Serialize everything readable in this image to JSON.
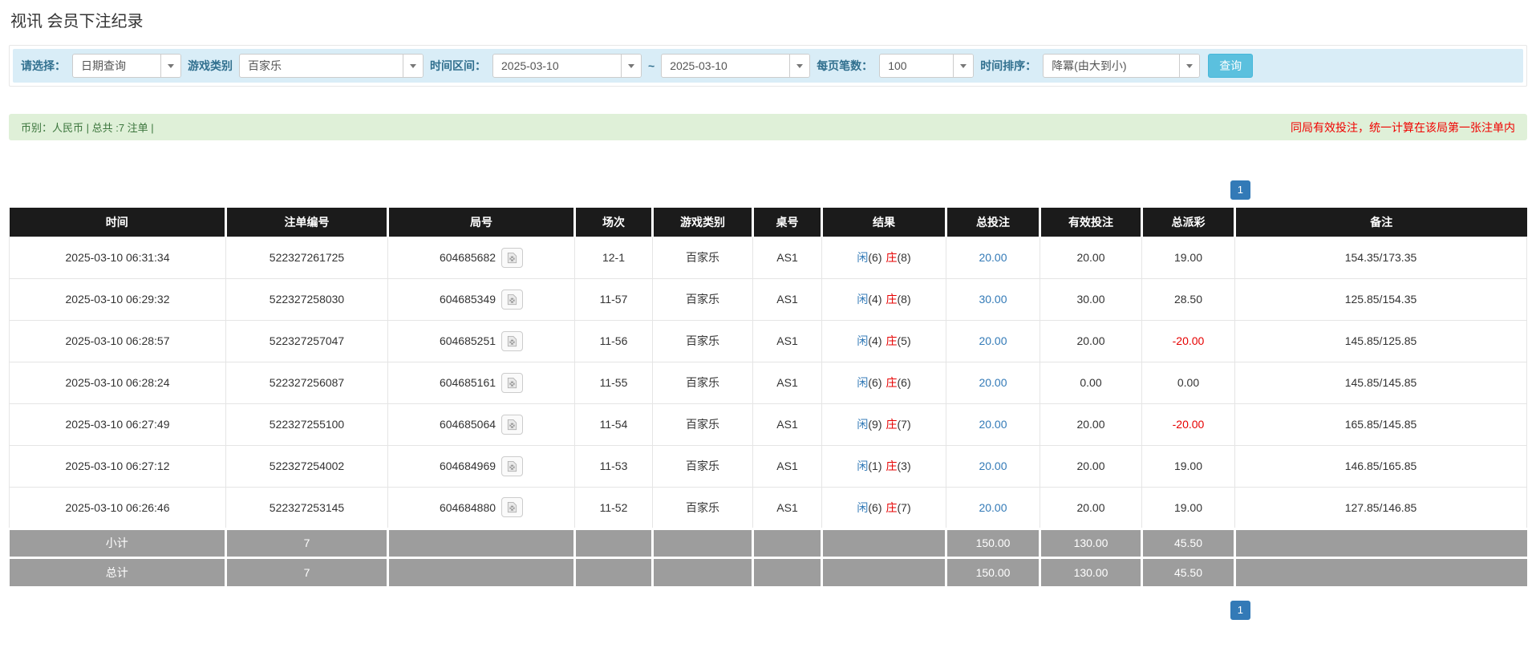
{
  "page_title": "视讯 会员下注纪录",
  "filter_bar": {
    "select_mode": {
      "label": "请选择：",
      "value": "日期查询"
    },
    "game_type": {
      "label": "游戏类别",
      "value": "百家乐"
    },
    "date_range": {
      "label": "时间区间：",
      "from": "2025-03-10",
      "separator": "~",
      "to": "2025-03-10"
    },
    "page_size": {
      "label": "每页笔数：",
      "value": "100"
    },
    "time_order": {
      "label": "时间排序：",
      "value": "降冪(由大到小)"
    },
    "query_button": "查询"
  },
  "summary_bar": {
    "left_text": "币别：人民币 | 总共 :7 注单 |",
    "right_notice": "同局有效投注，统一计算在该局第一张注单内"
  },
  "pagination": {
    "current_page": "1"
  },
  "icons": {
    "round_replay": "video-replay-icon",
    "select_caret": "chevron-down-icon"
  },
  "colors": {
    "accent_blue": "#337ab7",
    "info_bg": "#d9edf7",
    "success_bg": "#dff0d8",
    "header_bg": "#1b1b1b",
    "footer_bg": "#9d9d9d",
    "danger_red": "#e60000",
    "notice_red": "#f00200",
    "query_btn": "#5bc0de"
  },
  "table": {
    "headers": [
      "时间",
      "注单编号",
      "局号",
      "场次",
      "游戏类别",
      "桌号",
      "结果",
      "总投注",
      "有效投注",
      "总派彩",
      "备注"
    ],
    "rows": [
      {
        "time": "2025-03-10 06:31:34",
        "bet_id": "522327261725",
        "round_id": "604685682",
        "session": "12-1",
        "game": "百家乐",
        "table_no": "AS1",
        "result": {
          "player_label": "闲",
          "player_score": "(6)",
          "banker_label": "庄",
          "banker_score": "(8)"
        },
        "total_bet": "20.00",
        "valid_bet": "20.00",
        "payout": "19.00",
        "remark": "154.35/173.35"
      },
      {
        "time": "2025-03-10 06:29:32",
        "bet_id": "522327258030",
        "round_id": "604685349",
        "session": "11-57",
        "game": "百家乐",
        "table_no": "AS1",
        "result": {
          "player_label": "闲",
          "player_score": "(4)",
          "banker_label": "庄",
          "banker_score": "(8)"
        },
        "total_bet": "30.00",
        "valid_bet": "30.00",
        "payout": "28.50",
        "remark": "125.85/154.35"
      },
      {
        "time": "2025-03-10 06:28:57",
        "bet_id": "522327257047",
        "round_id": "604685251",
        "session": "11-56",
        "game": "百家乐",
        "table_no": "AS1",
        "result": {
          "player_label": "闲",
          "player_score": "(4)",
          "banker_label": "庄",
          "banker_score": "(5)"
        },
        "total_bet": "20.00",
        "valid_bet": "20.00",
        "payout": "-20.00",
        "remark": "145.85/125.85"
      },
      {
        "time": "2025-03-10 06:28:24",
        "bet_id": "522327256087",
        "round_id": "604685161",
        "session": "11-55",
        "game": "百家乐",
        "table_no": "AS1",
        "result": {
          "player_label": "闲",
          "player_score": "(6)",
          "banker_label": "庄",
          "banker_score": "(6)"
        },
        "total_bet": "20.00",
        "valid_bet": "0.00",
        "payout": "0.00",
        "remark": "145.85/145.85"
      },
      {
        "time": "2025-03-10 06:27:49",
        "bet_id": "522327255100",
        "round_id": "604685064",
        "session": "11-54",
        "game": "百家乐",
        "table_no": "AS1",
        "result": {
          "player_label": "闲",
          "player_score": "(9)",
          "banker_label": "庄",
          "banker_score": "(7)"
        },
        "total_bet": "20.00",
        "valid_bet": "20.00",
        "payout": "-20.00",
        "remark": "165.85/145.85"
      },
      {
        "time": "2025-03-10 06:27:12",
        "bet_id": "522327254002",
        "round_id": "604684969",
        "session": "11-53",
        "game": "百家乐",
        "table_no": "AS1",
        "result": {
          "player_label": "闲",
          "player_score": "(1)",
          "banker_label": "庄",
          "banker_score": "(3)"
        },
        "total_bet": "20.00",
        "valid_bet": "20.00",
        "payout": "19.00",
        "remark": "146.85/165.85"
      },
      {
        "time": "2025-03-10 06:26:46",
        "bet_id": "522327253145",
        "round_id": "604684880",
        "session": "11-52",
        "game": "百家乐",
        "table_no": "AS1",
        "result": {
          "player_label": "闲",
          "player_score": "(6)",
          "banker_label": "庄",
          "banker_score": "(7)"
        },
        "total_bet": "20.00",
        "valid_bet": "20.00",
        "payout": "19.00",
        "remark": "127.85/146.85"
      }
    ],
    "subtotal": {
      "label": "小计",
      "count": "7",
      "total_bet": "150.00",
      "valid_bet": "130.00",
      "payout": "45.50"
    },
    "total": {
      "label": "总计",
      "count": "7",
      "total_bet": "150.00",
      "valid_bet": "130.00",
      "payout": "45.50"
    }
  }
}
